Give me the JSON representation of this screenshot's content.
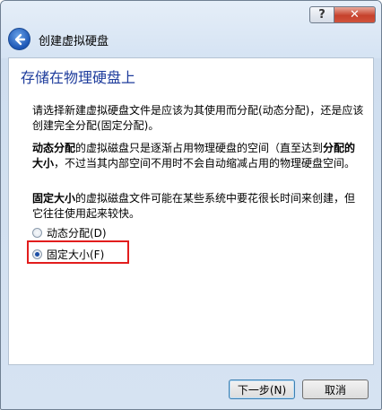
{
  "window": {
    "help_label": "?",
    "close_label": "✕",
    "title": "创建虚拟硬盘"
  },
  "page": {
    "heading": "存储在物理硬盘上",
    "intro": "请选择新建虚拟硬盘文件是应该为其使用而分配(动态分配)，还是应该创建完全分配(固定分配)。",
    "dynamic_bold": "动态分配",
    "dynamic_text": "的虚拟磁盘只是逐渐占用物理硬盘的空间（直至达到",
    "dynamic_bold2": "分配的大小",
    "dynamic_text2": "，不过当其内部空间不用时不会自动缩减占用的物理硬盘空间。",
    "fixed_bold": "固定大小",
    "fixed_text": "的虚拟磁盘文件可能在某些系统中要花很长时间来创建，但它往往使用起来较快。"
  },
  "options": {
    "dynamic_label": "动态分配(D)",
    "fixed_label": "固定大小(F)",
    "selected": "fixed"
  },
  "buttons": {
    "next_label": "下一步(N)",
    "cancel_label": "取消"
  },
  "colors": {
    "heading": "#1e3c9c",
    "highlight": "#e21d1d"
  },
  "icons": {
    "back": "back-arrow-icon"
  }
}
